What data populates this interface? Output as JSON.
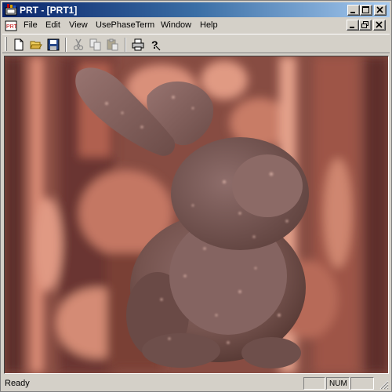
{
  "window": {
    "title": "PRT - [PRT1]"
  },
  "menu": {
    "items": [
      {
        "label": "File"
      },
      {
        "label": "Edit"
      },
      {
        "label": "View"
      },
      {
        "label": "UsePhaseTerm"
      },
      {
        "label": "Window"
      },
      {
        "label": "Help"
      }
    ]
  },
  "toolbar": {
    "buttons": [
      {
        "icon": "new-file-icon",
        "enabled": true
      },
      {
        "icon": "open-folder-icon",
        "enabled": true
      },
      {
        "icon": "save-disk-icon",
        "enabled": true
      },
      {
        "icon": "cut-scissors-icon",
        "enabled": false
      },
      {
        "icon": "copy-icon",
        "enabled": false
      },
      {
        "icon": "paste-icon",
        "enabled": false
      },
      {
        "icon": "print-icon",
        "enabled": true
      },
      {
        "icon": "help-question-icon",
        "enabled": true
      }
    ]
  },
  "viewport": {
    "content": "bunny-render",
    "colors": {
      "background": "#8a4e44",
      "bunny": "#7a5a57",
      "pattern": "#e0957c"
    }
  },
  "statusbar": {
    "text": "Ready",
    "panes": [
      "",
      "NUM",
      ""
    ]
  },
  "colors": {
    "titlebar_start": "#0a246a",
    "titlebar_end": "#a6caf0",
    "chrome": "#d4d0c8"
  }
}
